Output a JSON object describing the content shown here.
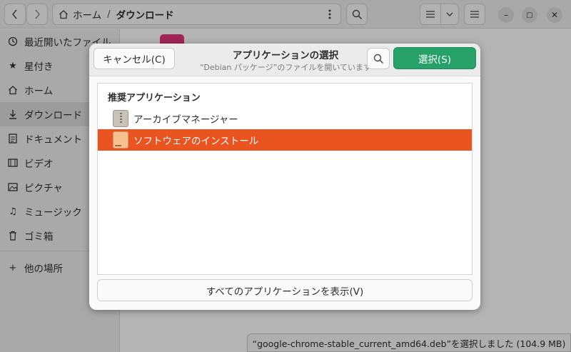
{
  "file_manager": {
    "path": {
      "home": "ホーム",
      "separator": "/",
      "current": "ダウンロード"
    },
    "sidebar": {
      "items": [
        {
          "label": "最近開いたファイル",
          "icon": "clock-icon"
        },
        {
          "label": "星付き",
          "icon": "star-icon"
        },
        {
          "label": "ホーム",
          "icon": "home-icon"
        },
        {
          "label": "ダウンロード",
          "icon": "download-icon",
          "active": true
        },
        {
          "label": "ドキュメント",
          "icon": "document-icon"
        },
        {
          "label": "ビデオ",
          "icon": "video-icon"
        },
        {
          "label": "ピクチャ",
          "icon": "picture-icon"
        },
        {
          "label": "ミュージック",
          "icon": "music-icon"
        },
        {
          "label": "ゴミ箱",
          "icon": "trash-icon"
        }
      ],
      "other": {
        "label": "他の場所",
        "icon": "plus-icon"
      }
    },
    "status": "“google-chrome-stable_current_amd64.deb”を選択しました (104.9 MB)"
  },
  "dialog": {
    "cancel_label": "キャンセル(C)",
    "title": "アプリケーションの選択",
    "subtitle": "“Debian パッケージ”のファイルを開いています",
    "select_label": "選択(S)",
    "select_color": "#26a269",
    "section_heading": "推奨アプリケーション",
    "apps": [
      {
        "label": "アーカイブマネージャー",
        "icon": "archive-manager-icon"
      },
      {
        "label": "ソフトウェアのインストール",
        "icon": "software-install-icon",
        "selected": true,
        "highlight_color": "#e95420"
      }
    ],
    "show_all_label": "すべてのアプリケーションを表示(V)"
  }
}
